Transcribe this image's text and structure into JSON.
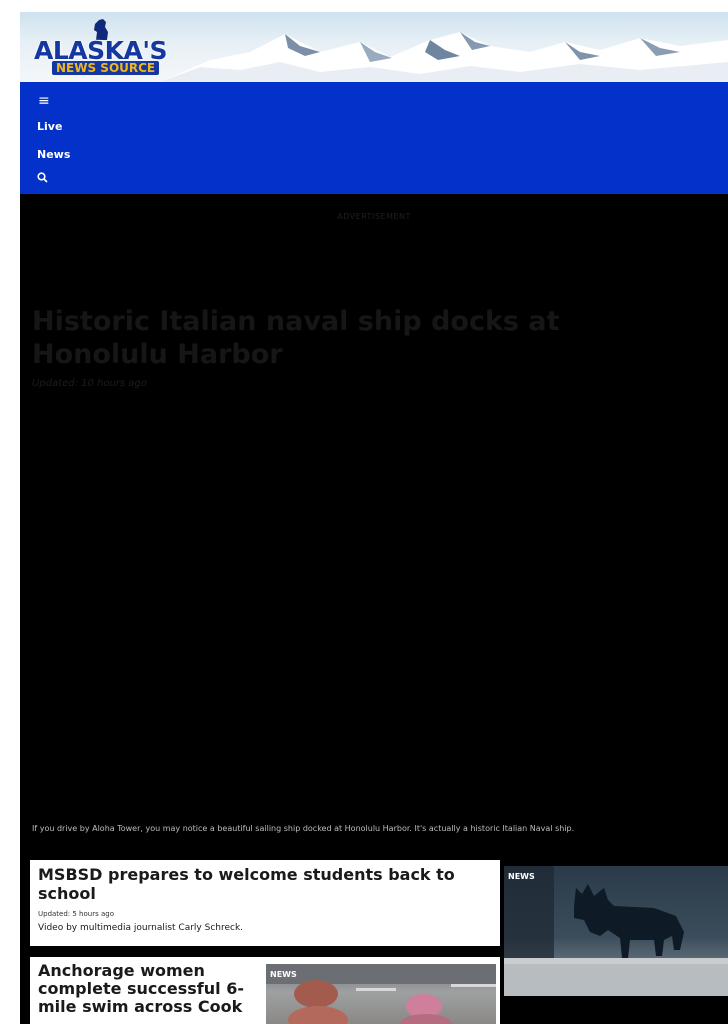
{
  "header": {
    "logo_top": "ALASKA'S",
    "logo_bottom": "NEWS SOURCE"
  },
  "nav": {
    "items": [
      {
        "label": "Live"
      },
      {
        "label": "News"
      }
    ]
  },
  "hero": {
    "ad_label": "ADVERTISEMENT",
    "title": "Historic Italian naval ship docks at Honolulu Harbor",
    "updated": "Updated: 10 hours ago",
    "description": "If you drive by Aloha Tower, you may notice a beautiful sailing ship docked at Honolulu Harbor. It's actually a historic Italian Naval ship."
  },
  "stories": [
    {
      "title": "MSBSD prepares to welcome students back to school",
      "updated": "Updated: 5 hours ago",
      "description": "Video by multimedia journalist Carly Schreck.",
      "tag": "NEWS"
    },
    {
      "title": "Anchorage women complete successful 6-mile swim across Cook",
      "tag": "NEWS"
    }
  ],
  "colors": {
    "nav_bg": "#0431c9",
    "logo_blue": "#1537a0",
    "logo_gold": "#f2b61b",
    "hero_bg": "#000000"
  },
  "icons": {
    "menu": "hamburger-icon",
    "search": "search-icon",
    "logo_figure": "bear-icon"
  }
}
